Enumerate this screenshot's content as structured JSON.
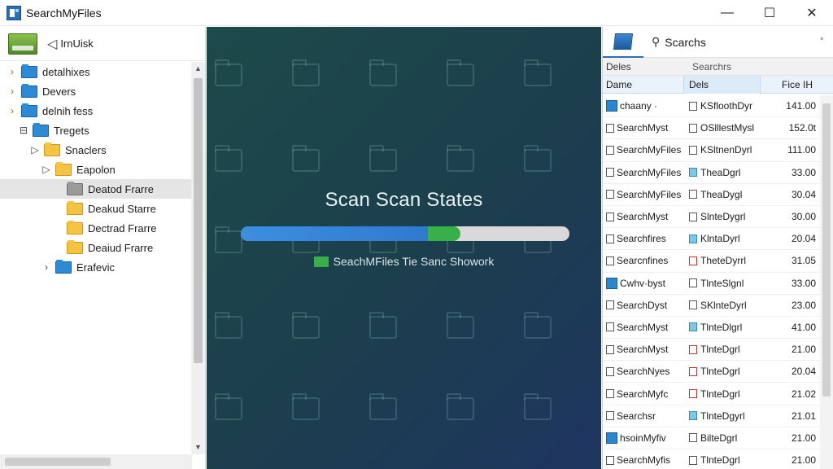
{
  "window": {
    "title": "SearchMyFiles",
    "minimize": "—",
    "maximize": "☐",
    "close": "✕"
  },
  "left": {
    "header_label": "IrnUisk",
    "tree": [
      {
        "label": "detalhixes",
        "chevron": "›",
        "folder": "blue",
        "indent": 0
      },
      {
        "label": "Devers",
        "chevron": "›",
        "folder": "blue",
        "indent": 0
      },
      {
        "label": "delnih fess",
        "chevron": "›",
        "folder": "blue",
        "indent": 0
      },
      {
        "label": "Tregets",
        "chevron": "⊟",
        "folder": "blue",
        "indent": 1
      },
      {
        "label": "Snaclers",
        "chevron": "▷",
        "folder": "yellow",
        "indent": 2
      },
      {
        "label": "Eapolon",
        "chevron": "▷",
        "folder": "yellow",
        "indent": 3
      },
      {
        "label": "Deatod Frarre",
        "chevron": "",
        "folder": "gray",
        "indent": 4,
        "selected": true
      },
      {
        "label": "Deakud Starre",
        "chevron": "",
        "folder": "yellow",
        "indent": 4
      },
      {
        "label": "Dectrad Frarre",
        "chevron": "",
        "folder": "yellow",
        "indent": 4
      },
      {
        "label": "Deaiud Frarre",
        "chevron": "",
        "folder": "yellow",
        "indent": 4
      },
      {
        "label": "Erafevic",
        "chevron": "›",
        "folder": "blue",
        "indent": 3
      }
    ]
  },
  "center": {
    "title": "Scan Scan States",
    "status": "SeachMFiles Tie Sanc Showork",
    "progress_blue": 0.57,
    "progress_green": 0.1
  },
  "right": {
    "search_tab_label": "Scarchs",
    "tab_close": "˟",
    "sub_left": "Deles",
    "sub_right": "Searchrs",
    "columns": [
      "Dame",
      "Dels",
      "Fice IH"
    ],
    "rows": [
      {
        "name": "chaany ·",
        "dels": "KSfloothDyr",
        "size": "141.00",
        "icon": "blue",
        "icon2": ""
      },
      {
        "name": "SearchMyst",
        "dels": "OSlllestMysl",
        "size": "152.0t",
        "icon": "",
        "icon2": ""
      },
      {
        "name": "SearchMyFiles",
        "dels": "KSltnenDyrl",
        "size": "111.00",
        "icon": "",
        "icon2": ""
      },
      {
        "name": "SearchMyFiles",
        "dels": "TheaDgrl",
        "size": "33.00",
        "icon": "",
        "icon2": "teal"
      },
      {
        "name": "SearchMyFiles",
        "dels": "TheaDygl",
        "size": "30.04",
        "icon": "",
        "icon2": ""
      },
      {
        "name": "SearchMyst",
        "dels": "SlnteDygrl",
        "size": "30.00",
        "icon": "",
        "icon2": ""
      },
      {
        "name": "Searchfires",
        "dels": "KlntaDyrl",
        "size": "20.04",
        "icon": "",
        "icon2": "teal"
      },
      {
        "name": "Searcnfines",
        "dels": "TheteDyrrl",
        "size": "31.05",
        "icon": "",
        "icon2": "red"
      },
      {
        "name": "Cwhv·byst",
        "dels": "TlnteSlgnl",
        "size": "33.00",
        "icon": "blue",
        "icon2": ""
      },
      {
        "name": "SearchDyst",
        "dels": "SKlnteDyrl",
        "size": "23.00",
        "icon": "",
        "icon2": ""
      },
      {
        "name": "SearchMyst",
        "dels": "TlnteDlgrl",
        "size": "41.00",
        "icon": "",
        "icon2": "teal"
      },
      {
        "name": "SearchMyst",
        "dels": "TlnteDgrl",
        "size": "21.00",
        "icon": "",
        "icon2": "red"
      },
      {
        "name": "SearchNyes",
        "dels": "TlnteDgrl",
        "size": "20.04",
        "icon": "",
        "icon2": "red"
      },
      {
        "name": "SearchMyfc",
        "dels": "TlnteDgrl",
        "size": "21.02",
        "icon": "",
        "icon2": "red"
      },
      {
        "name": "Searchsr",
        "dels": "TlnteDgyrl",
        "size": "21.01",
        "icon": "",
        "icon2": "teal"
      },
      {
        "name": "hsoinMyfiv",
        "dels": "BilteDgrl",
        "size": "21.00",
        "icon": "blue",
        "icon2": ""
      },
      {
        "name": "SearchMyfis",
        "dels": "TlnteDgrl",
        "size": "21.00",
        "icon": "",
        "icon2": ""
      }
    ]
  },
  "colors": {
    "accent": "#2a6fb3",
    "progress_blue": "#3c8ee0",
    "progress_green": "#37b04a",
    "center_bg": "#1d4a4a"
  }
}
